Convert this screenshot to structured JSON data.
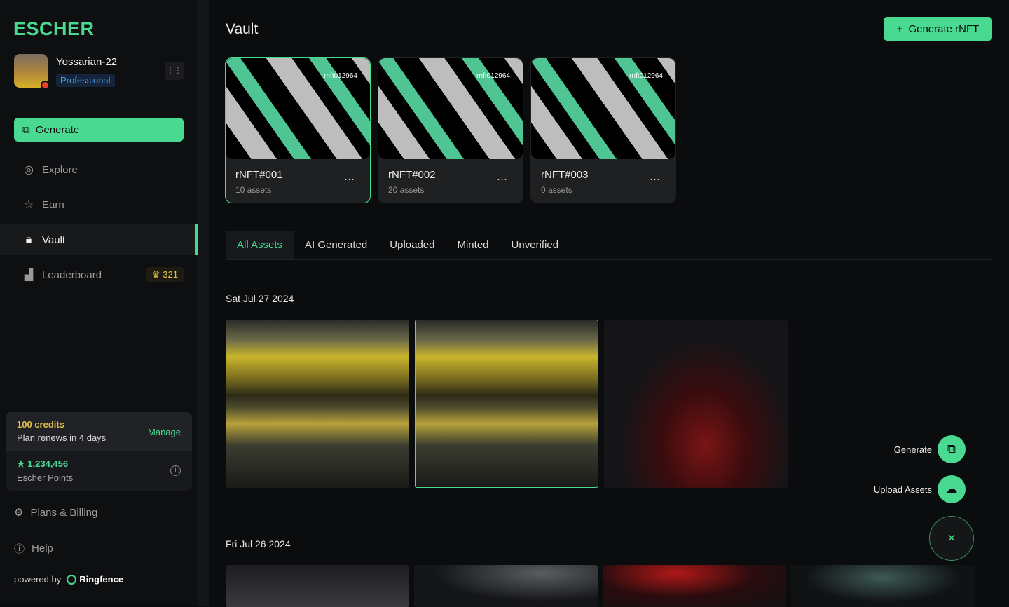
{
  "brand": "ESCHER",
  "user": {
    "name": "Yossarian-22",
    "plan": "Professional"
  },
  "sidebar": {
    "generate": "Generate",
    "items": [
      {
        "label": "Explore",
        "icon": "compass-icon"
      },
      {
        "label": "Earn",
        "icon": "star-icon"
      },
      {
        "label": "Vault",
        "icon": "lock-icon",
        "active": true
      },
      {
        "label": "Leaderboard",
        "icon": "podium-icon",
        "badge": "321"
      }
    ],
    "credits": {
      "amount": "100 credits",
      "renew": "Plan renews in 4 days",
      "manage": "Manage"
    },
    "points": {
      "value": "1,234,456",
      "label": "Escher Points"
    },
    "plans": "Plans & Billing",
    "help": "Help",
    "powered": "powered by",
    "partner": "Ringfence"
  },
  "main": {
    "title": "Vault",
    "generate_rnft": "Generate rNFT",
    "cards": [
      {
        "name": "rNFT#001",
        "count": "10 assets",
        "id": "rnft012964"
      },
      {
        "name": "rNFT#002",
        "count": "20 assets",
        "id": "rnft012964"
      },
      {
        "name": "rNFT#003",
        "count": "0 assets",
        "id": "rnft012964"
      }
    ],
    "tabs": [
      "All Assets",
      "AI Generated",
      "Uploaded",
      "Minted",
      "Unverified"
    ],
    "groups": [
      {
        "date": "Sat Jul 27 2024"
      },
      {
        "date": "Fri Jul 26 2024"
      }
    ],
    "fab": {
      "generate": "Generate",
      "upload": "Upload Assets",
      "close": "×"
    }
  },
  "colors": {
    "accent": "#4ad991",
    "gold": "#e3c04e",
    "plan": "#4f9ee8"
  }
}
